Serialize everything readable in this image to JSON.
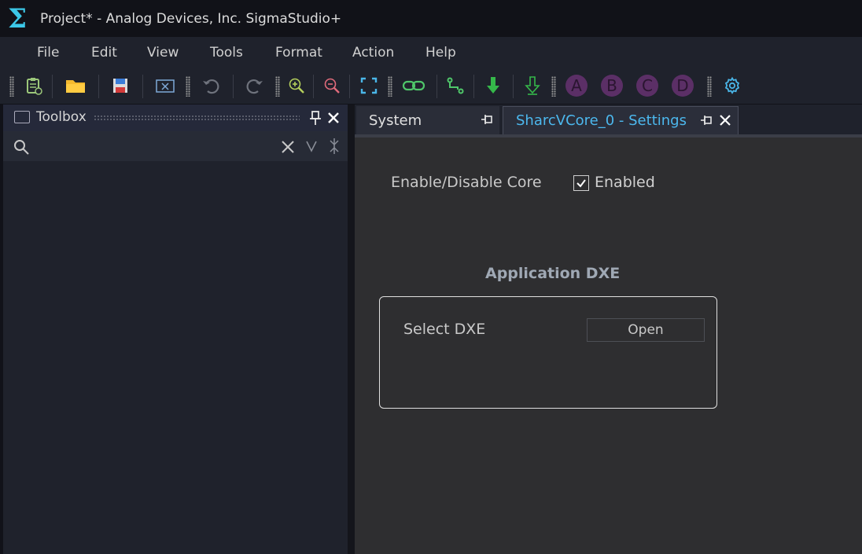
{
  "window": {
    "title": "Project* - Analog Devices, Inc. SigmaStudio+",
    "app_icon_glyph": "Σ",
    "accent": "#3cc8e8"
  },
  "menu": {
    "items": [
      "File",
      "Edit",
      "View",
      "Tools",
      "Format",
      "Action",
      "Help"
    ]
  },
  "toolbar": {
    "buttons": [
      {
        "icon": "clipboard-icon"
      },
      {
        "icon": "open-folder-icon"
      },
      {
        "icon": "save-icon"
      },
      {
        "icon": "close-project-icon"
      },
      {
        "icon": "undo-icon"
      },
      {
        "icon": "redo-icon"
      },
      {
        "icon": "zoom-in-icon"
      },
      {
        "icon": "zoom-out-icon"
      },
      {
        "icon": "fit-to-window-icon"
      },
      {
        "icon": "link-icon"
      },
      {
        "icon": "wire-icon"
      },
      {
        "icon": "download-icon"
      },
      {
        "icon": "download-outline-icon"
      },
      {
        "icon": "gear-icon"
      }
    ],
    "letter_buttons": [
      "A",
      "B",
      "C",
      "D"
    ]
  },
  "toolbox": {
    "title": "Toolbox",
    "search": {
      "value": "",
      "placeholder": ""
    }
  },
  "tabs": [
    {
      "label": "System",
      "active": false
    },
    {
      "label": "SharcVCore_0 - Settings",
      "active": true,
      "color": "#4cb8ee"
    }
  ],
  "settings": {
    "core_label": "Enable/Disable Core",
    "enabled_checked": true,
    "enabled_label": "Enabled",
    "group_title": "Application DXE",
    "select_dxe_label": "Select DXE",
    "open_button_label": "Open"
  }
}
